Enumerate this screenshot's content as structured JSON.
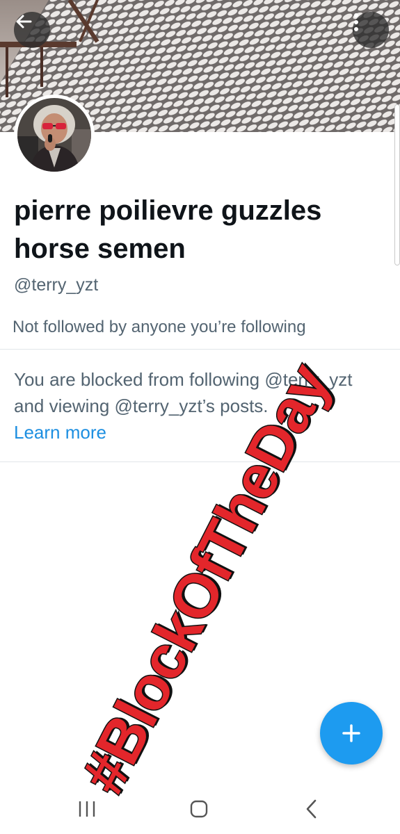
{
  "profile": {
    "display_name": "pierre poilievre guzzles horse semen",
    "handle": "@terry_yzt",
    "followers_note": "Not followed by anyone you’re following"
  },
  "blocked": {
    "message": "You are blocked from following @terry_yzt and viewing @terry_yzt’s posts.",
    "learn_more": "Learn more"
  },
  "overlay": {
    "text": "#BlockOfTheDay",
    "color": "#e3262b"
  },
  "icons": {
    "back": "arrow-left-icon",
    "more": "more-vertical-icon",
    "compose": "plus-icon",
    "nav_recent": "recent-apps-icon",
    "nav_home": "home-icon",
    "nav_back": "chevron-left-icon"
  },
  "colors": {
    "accent": "#1d9bf0",
    "secondary_text": "#536471"
  }
}
